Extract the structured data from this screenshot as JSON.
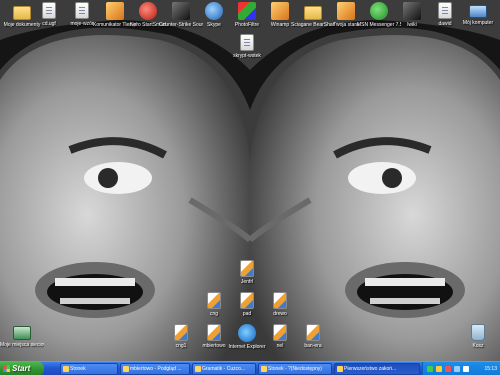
{
  "desktop": {
    "icons_top": [
      {
        "label": "Moje dokumenty"
      },
      {
        "label": "cd.ugf"
      },
      {
        "label": "moje-wzór"
      },
      {
        "label": "Komunikator Tlen.pl"
      },
      {
        "label": "Nero StartSmart"
      },
      {
        "label": "Counter-Strike Source"
      },
      {
        "label": "Skype"
      },
      {
        "label": "PhotoFiltre"
      },
      {
        "label": "Winamp"
      },
      {
        "label": "Sciagane BearShare"
      },
      {
        "label": "Twoja stara"
      },
      {
        "label": "MSN Messenger 7.5"
      },
      {
        "label": "lwiki"
      },
      {
        "label": "dawid"
      },
      {
        "label": "Mój komputer"
      }
    ],
    "icon_shortcut": {
      "label": "skrypt-wstek"
    },
    "icons_middle": [
      {
        "label": "Jenfrl"
      },
      {
        "label": "cng"
      },
      {
        "label": "pad"
      },
      {
        "label": "drewo"
      }
    ],
    "icons_bottom": [
      {
        "label": "cng1"
      },
      {
        "label": "mbiertowo"
      },
      {
        "label": "Internet Explorer"
      },
      {
        "label": "nel"
      },
      {
        "label": "ban-era"
      }
    ],
    "icon_network": {
      "label": "Moje miejsca sieciowe"
    },
    "icon_bin": {
      "label": "Kosz"
    }
  },
  "taskbar": {
    "start_label": "Start",
    "tasks": [
      {
        "label": "Stonek"
      },
      {
        "label": "mbiertowo - Podgląd ..."
      },
      {
        "label": "Gramatik - Cuzco..."
      },
      {
        "label": "Stonek - ?(Niedostępny)"
      },
      {
        "label": "Pierwszeństwo zakoń..."
      }
    ],
    "clock": "15:13"
  }
}
